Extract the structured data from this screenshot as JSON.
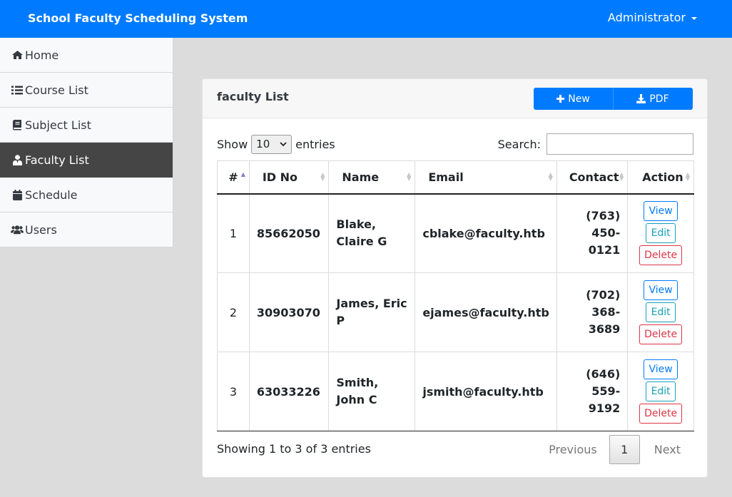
{
  "app": {
    "title": "School Faculty Scheduling System",
    "user_menu": "Administrator"
  },
  "sidebar": {
    "items": [
      {
        "label": "Home",
        "icon": "home-icon",
        "active": false
      },
      {
        "label": "Course List",
        "icon": "list-icon",
        "active": false
      },
      {
        "label": "Subject List",
        "icon": "book-icon",
        "active": false
      },
      {
        "label": "Faculty List",
        "icon": "user-tie-icon",
        "active": true
      },
      {
        "label": "Schedule",
        "icon": "calendar-icon",
        "active": false
      },
      {
        "label": "Users",
        "icon": "users-icon",
        "active": false
      }
    ]
  },
  "card": {
    "title": "faculty List",
    "new_label": "New",
    "pdf_label": "PDF"
  },
  "controls": {
    "show_label": "Show",
    "entries_value": "10",
    "entries_label": "entries",
    "search_label": "Search:",
    "search_value": ""
  },
  "table": {
    "columns": [
      "#",
      "ID No",
      "Name",
      "Email",
      "Contact",
      "Action"
    ],
    "rows": [
      {
        "num": "1",
        "id": "85662050",
        "name": "Blake, Claire G",
        "email": "cblake@faculty.htb",
        "contact_area": "(763)",
        "contact_num": "450-0121"
      },
      {
        "num": "2",
        "id": "30903070",
        "name": "James, Eric P",
        "email": "ejames@faculty.htb",
        "contact_area": "(702)",
        "contact_num": "368-3689"
      },
      {
        "num": "3",
        "id": "63033226",
        "name": "Smith, John C",
        "email": "jsmith@faculty.htb",
        "contact_area": "(646)",
        "contact_num": "559-9192"
      }
    ],
    "actions": {
      "view": "View",
      "edit": "Edit",
      "delete": "Delete"
    }
  },
  "footer": {
    "info": "Showing 1 to 3 of 3 entries",
    "previous": "Previous",
    "current_page": "1",
    "next": "Next"
  },
  "colors": {
    "primary": "#007bff",
    "sidebar_active": "#454545",
    "danger": "#dc3545",
    "info": "#17a2b8"
  }
}
